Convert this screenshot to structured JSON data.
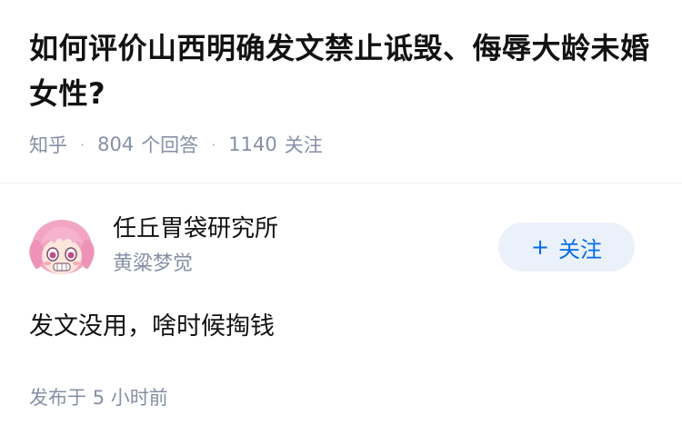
{
  "question": {
    "title": "如何评价山西明确发文禁止诋毁、侮辱大龄未婚女性?",
    "source": "知乎",
    "answer_count": "804",
    "answer_label": "个回答",
    "follower_count": "1140",
    "follower_label": "关注"
  },
  "answer": {
    "author_name": "任丘胃袋研究所",
    "author_headline": "黄粱梦觉",
    "follow_label": "关注",
    "follow_icon": "plus-icon",
    "content": "发文没用，啥时候掏钱",
    "time_prefix": "发布于",
    "time_value": "5 小时前"
  },
  "colors": {
    "accent": "#056de8",
    "follow_bg": "#ebf1fa",
    "meta_text": "#8590a6",
    "avatar_hair": "#f2a6c4"
  }
}
